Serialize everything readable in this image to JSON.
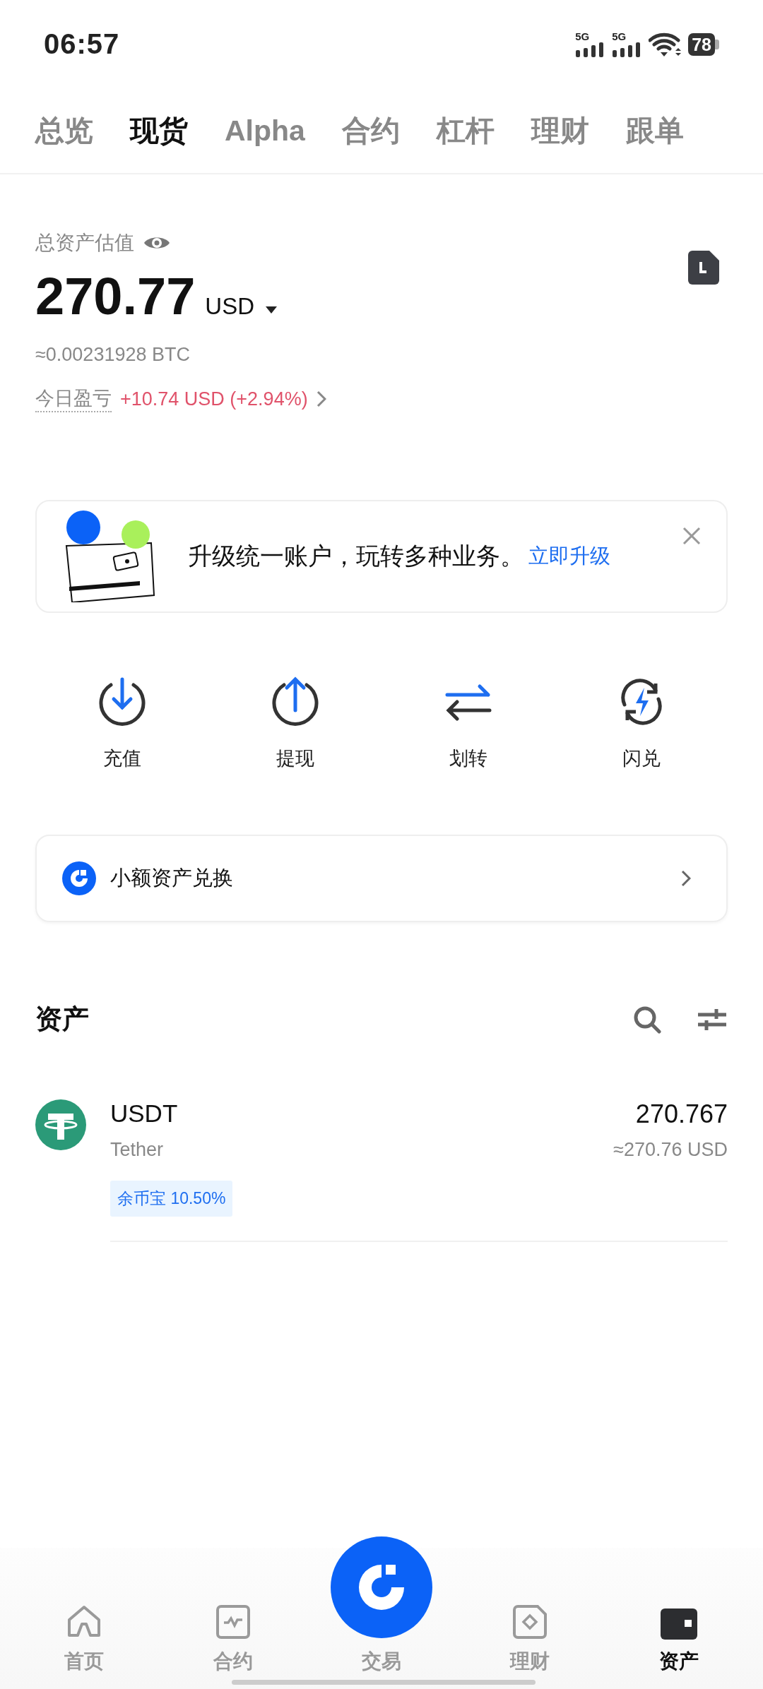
{
  "status_bar": {
    "time": "06:57",
    "signals": [
      "5G",
      "5G"
    ],
    "battery": "78"
  },
  "tabs": [
    {
      "label": "总览",
      "selected": false
    },
    {
      "label": "现货",
      "selected": true
    },
    {
      "label": "Alpha",
      "selected": false
    },
    {
      "label": "合约",
      "selected": false
    },
    {
      "label": "杠杆",
      "selected": false
    },
    {
      "label": "理财",
      "selected": false
    },
    {
      "label": "跟单",
      "selected": false
    }
  ],
  "summary": {
    "label": "总资产估值",
    "amount": "270.77",
    "currency": "USD",
    "btc": "≈0.00231928 BTC",
    "pnl_label": "今日盈亏",
    "pnl": "+10.74 USD (+2.94%)"
  },
  "banner": {
    "text": "升级统一账户，玩转多种业务。",
    "link": "立即升级"
  },
  "actions": [
    {
      "label": "充值",
      "kind": "deposit"
    },
    {
      "label": "提现",
      "kind": "withdraw"
    },
    {
      "label": "划转",
      "kind": "transfer"
    },
    {
      "label": "闪兑",
      "kind": "convert"
    }
  ],
  "small_assets": {
    "label": "小额资产兑换"
  },
  "assets": {
    "title": "资产",
    "items": [
      {
        "symbol": "USDT",
        "name": "Tether",
        "amount": "270.767",
        "value": "≈270.76 USD",
        "tag": "余币宝 10.50%"
      }
    ]
  },
  "bottom_nav": [
    {
      "label": "首页",
      "kind": "home",
      "selected": false
    },
    {
      "label": "合约",
      "kind": "futures",
      "selected": false
    },
    {
      "label": "交易",
      "kind": "trade",
      "selected": false
    },
    {
      "label": "理财",
      "kind": "earn",
      "selected": false
    },
    {
      "label": "资产",
      "kind": "assets",
      "selected": true
    }
  ]
}
